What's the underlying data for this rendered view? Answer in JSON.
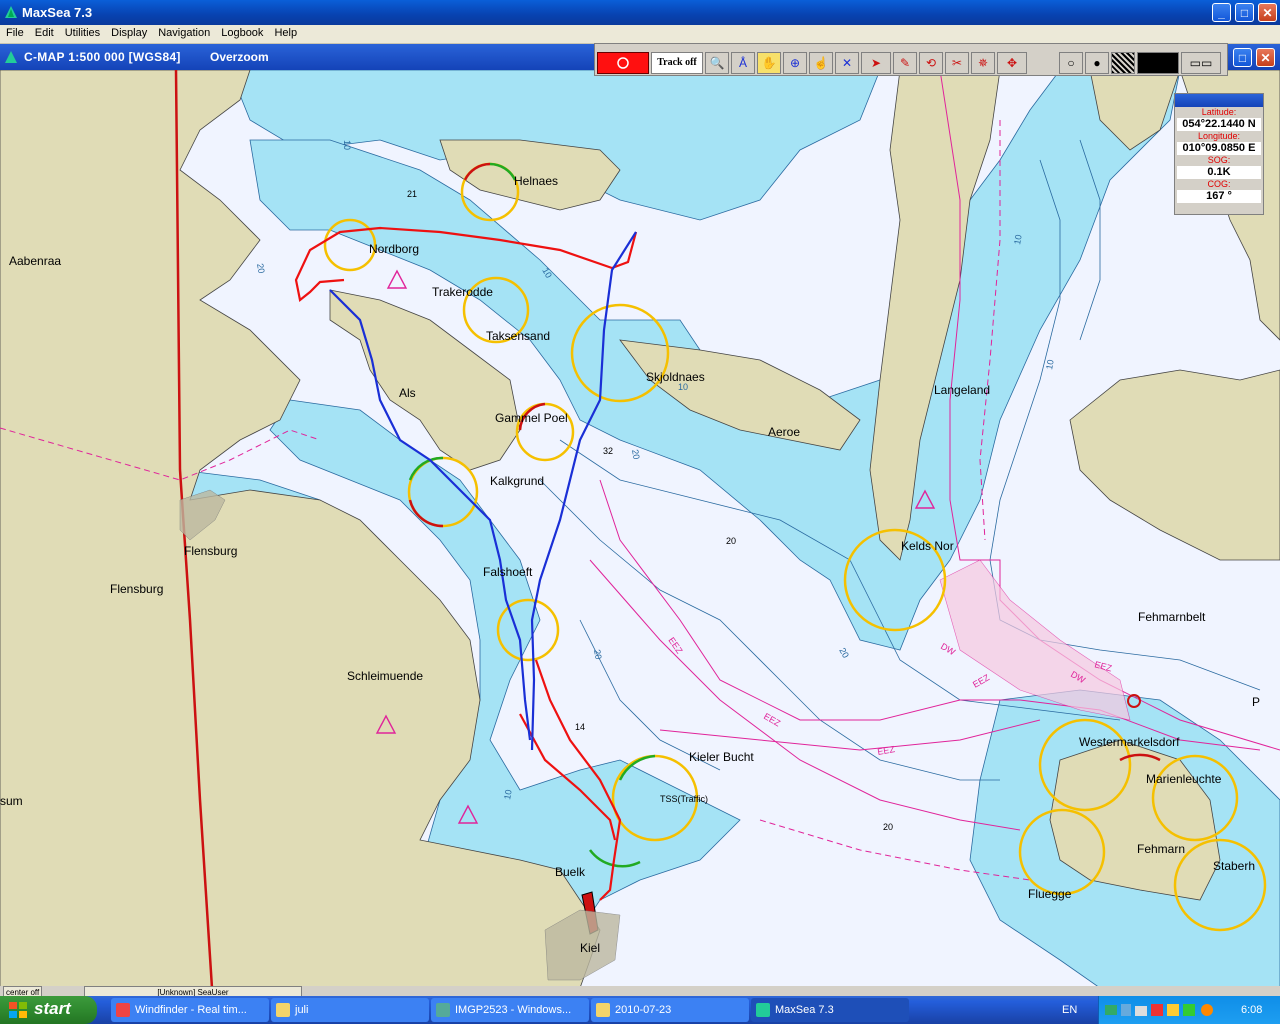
{
  "window": {
    "title": "MaxSea 7.3",
    "min_label": "_",
    "max_label": "□",
    "close_label": "✕"
  },
  "menu": [
    "File",
    "Edit",
    "Utilities",
    "Display",
    "Navigation",
    "Logbook",
    "Help"
  ],
  "chart_window": {
    "title": "C-MAP  1:500 000 [WGS84]",
    "zoom_state": "Overzoom"
  },
  "toolbar": {
    "track_label": "Track off"
  },
  "nav_panel": {
    "latitude_label": "Latitude:",
    "latitude": "054°22.1440 N",
    "longitude_label": "Longitude:",
    "longitude": "010°09.0850 E",
    "sog_label": "SOG:",
    "sog": "0.1K",
    "cog_label": "COG:",
    "cog": "167 °"
  },
  "map_labels": {
    "aabenraa": "Aabenraa",
    "helnaes": "Helnaes",
    "nordborg": "Nordborg",
    "trakerodde": "Trakerodde",
    "taksensand": "Taksensand",
    "skjoldnaes": "Skjoldnaes",
    "als": "Als",
    "gammel_poel": "Gammel Poel",
    "langeland": "Langeland",
    "aeroe": "Aeroe",
    "kalkgrund": "Kalkgrund",
    "flensburg1": "Flensburg",
    "flensburg2": "Flensburg",
    "falshoeft": "Falshoeft",
    "kelds_nor": "Kelds Nor",
    "fehmarnbelt": "Fehmarnbelt",
    "schleimuende": "Schleimuende",
    "kieler_bucht": "Kieler Bucht",
    "westermarkelsdorf": "Westermarkelsdorf",
    "marienleuchte": "Marienleuchte",
    "fehmarn": "Fehmarn",
    "staberh": "Staberh",
    "fluegge": "Fluegge",
    "buelk": "Buelk",
    "kiel": "Kiel",
    "sum": "sum",
    "traffic": "TSS(Traffic)",
    "eez1": "EEZ",
    "eez2": "EEZ",
    "eez3": "EEZ",
    "eez4": "EEZ",
    "eez5": "EEZ",
    "dw1": "DW",
    "dw2": "DW",
    "p": "P"
  },
  "depths": [
    "21",
    "32",
    "20",
    "14",
    "20",
    "10",
    "20",
    "10",
    "10",
    "20",
    "20",
    "10",
    "10",
    "20",
    "10"
  ],
  "status": {
    "center": "center off",
    "user": "[Unknown] SeaUser"
  },
  "taskbar": {
    "start": "start",
    "tasks": [
      "Windfinder - Real tim...",
      "juli",
      "IMGP2523 - Windows...",
      "2010-07-23",
      "MaxSea 7.3"
    ],
    "lang": "EN",
    "clock": "6:08"
  },
  "colors": {
    "land": "#e0dcb6",
    "shallow": "#a5e3f5",
    "deep": "#f0f4ff",
    "track_red": "#ee1111",
    "track_blue": "#1a2fd6",
    "border_red": "#cc1111",
    "magenta": "#e0249a",
    "light_sector": "#f5c000"
  }
}
